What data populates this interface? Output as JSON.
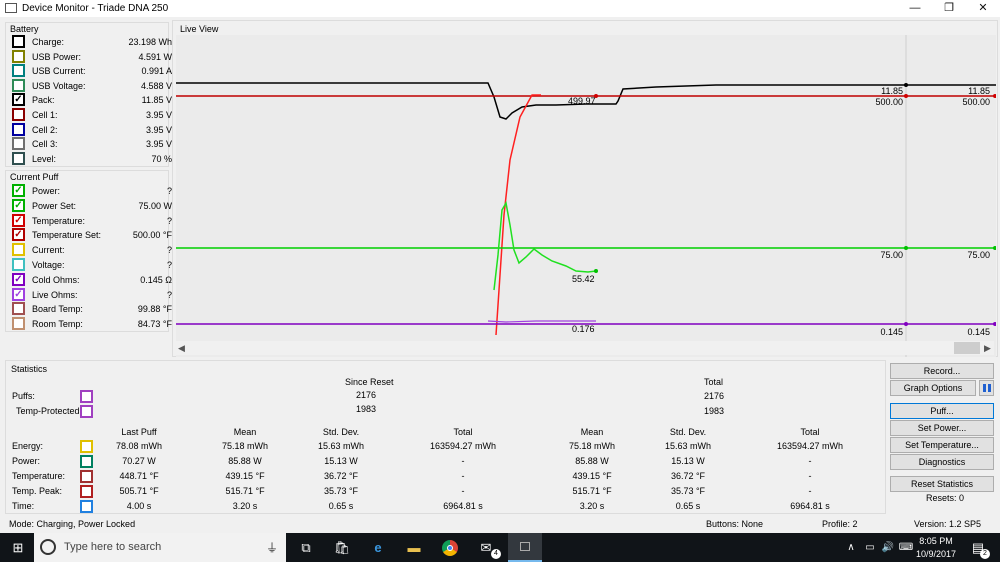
{
  "window": {
    "title": "Device Monitor - Triade DNA 250",
    "minimize": "—",
    "maximize": "❐",
    "close": "✕"
  },
  "battery": {
    "title": "Battery",
    "items": [
      {
        "label": "Charge:",
        "value": "23.198 Wh",
        "color": "#000000",
        "checked": false
      },
      {
        "label": "USB Power:",
        "value": "4.591 W",
        "color": "#808000",
        "checked": false
      },
      {
        "label": "USB Current:",
        "value": "0.991 A",
        "color": "#008080",
        "checked": false
      },
      {
        "label": "USB Voltage:",
        "value": "4.588 V",
        "color": "#2e8b57",
        "checked": false
      },
      {
        "label": "Pack:",
        "value": "11.85 V",
        "color": "#000000",
        "checked": true
      },
      {
        "label": "Cell 1:",
        "value": "3.95 V",
        "color": "#8b0000",
        "checked": false
      },
      {
        "label": "Cell 2:",
        "value": "3.95 V",
        "color": "#0000a0",
        "checked": false
      },
      {
        "label": "Cell 3:",
        "value": "3.95 V",
        "color": "#707070",
        "checked": false
      },
      {
        "label": "Level:",
        "value": "70 %",
        "color": "#2f4f4f",
        "checked": false
      }
    ]
  },
  "current_puff": {
    "title": "Current Puff",
    "items": [
      {
        "label": "Power:",
        "value": "?",
        "color": "#00b000",
        "checked": true
      },
      {
        "label": "Power Set:",
        "value": "75.00 W",
        "color": "#00b000",
        "checked": true
      },
      {
        "label": "Temperature:",
        "value": "?",
        "color": "#d00000",
        "checked": true
      },
      {
        "label": "Temperature Set:",
        "value": "500.00 °F",
        "color": "#b00000",
        "checked": true
      },
      {
        "label": "Current:",
        "value": "?",
        "color": "#e0c000",
        "checked": false
      },
      {
        "label": "Voltage:",
        "value": "?",
        "color": "#40c0c0",
        "checked": false
      },
      {
        "label": "Cold Ohms:",
        "value": "0.145 Ω",
        "color": "#8000c0",
        "checked": true
      },
      {
        "label": "Live Ohms:",
        "value": "?",
        "color": "#a040e0",
        "checked": true
      },
      {
        "label": "Board Temp:",
        "value": "99.88 °F",
        "color": "#a05050",
        "checked": false
      },
      {
        "label": "Room Temp:",
        "value": "84.73 °F",
        "color": "#c09070",
        "checked": false
      }
    ]
  },
  "live_view": {
    "title": "Live View",
    "labels": {
      "pack_mid": "499.97",
      "pack_r1": "11.85",
      "pack_r2": "11.85",
      "temp_r1": "500.00",
      "temp_r2": "500.00",
      "power_mid": "55.42",
      "power_r1": "75.00",
      "power_r2": "75.00",
      "ohms_mid": "0.176",
      "ohms_r1": "0.145",
      "ohms_r2": "0.145"
    }
  },
  "chart_data": {
    "type": "line",
    "series": [
      {
        "name": "Pack",
        "values": [
          11.85,
          11.85
        ]
      },
      {
        "name": "Temperature Set",
        "values": [
          500.0,
          500.0
        ]
      },
      {
        "name": "Power Set",
        "values": [
          75.0,
          75.0
        ]
      },
      {
        "name": "Power",
        "values": [
          55.42
        ]
      },
      {
        "name": "Cold Ohms",
        "values": [
          0.145,
          0.145
        ]
      },
      {
        "name": "Live Ohms",
        "values": [
          0.176
        ]
      }
    ],
    "colors": {
      "pack": "#000000",
      "temp": "#e00000",
      "power": "#00e000",
      "ohms": "#9030d0"
    }
  },
  "statistics": {
    "title": "Statistics",
    "since_reset": "Since Reset",
    "total": "Total",
    "puffs_label": "Puffs:",
    "temp_protected_label": "Temp-Protected:",
    "puffs_since": "2176",
    "puffs_total": "2176",
    "tp_since": "1983",
    "tp_total": "1983",
    "headers": [
      "Last Puff",
      "Mean",
      "Std. Dev.",
      "Total",
      "Mean",
      "Std. Dev.",
      "Total"
    ],
    "rows": [
      {
        "label": "Energy:",
        "color": "#e0c000",
        "vals": [
          "78.08 mWh",
          "75.18 mWh",
          "15.63 mWh",
          "163594.27 mWh",
          "75.18 mWh",
          "15.63 mWh",
          "163594.27 mWh"
        ]
      },
      {
        "label": "Power:",
        "color": "#008060",
        "vals": [
          "70.27 W",
          "85.88 W",
          "15.13 W",
          "-",
          "85.88 W",
          "15.13 W",
          "-"
        ]
      },
      {
        "label": "Temperature:",
        "color": "#a03030",
        "vals": [
          "448.71 °F",
          "439.15 °F",
          "36.72 °F",
          "-",
          "439.15 °F",
          "36.72 °F",
          "-"
        ]
      },
      {
        "label": "Temp. Peak:",
        "color": "#b02020",
        "vals": [
          "505.71 °F",
          "515.71 °F",
          "35.73 °F",
          "-",
          "515.71 °F",
          "35.73 °F",
          "-"
        ]
      },
      {
        "label": "Time:",
        "color": "#2080e0",
        "vals": [
          "4.00 s",
          "3.20 s",
          "0.65 s",
          "6964.81 s",
          "3.20 s",
          "0.65 s",
          "6964.81 s"
        ]
      }
    ]
  },
  "buttons": {
    "record": "Record...",
    "graph_options": "Graph Options",
    "puff": "Puff...",
    "set_power": "Set Power...",
    "set_temperature": "Set Temperature...",
    "diagnostics": "Diagnostics",
    "reset_statistics": "Reset Statistics",
    "resets": "Resets: 0"
  },
  "status": {
    "mode": "Mode: Charging, Power Locked",
    "buttons": "Buttons: None",
    "profile": "Profile: 2",
    "version": "Version: 1.2 SP5"
  },
  "taskbar": {
    "search_placeholder": "Type here to search",
    "time": "8:05 PM",
    "date": "10/9/2017",
    "mail_badge": "4",
    "notif_badge": "2"
  }
}
